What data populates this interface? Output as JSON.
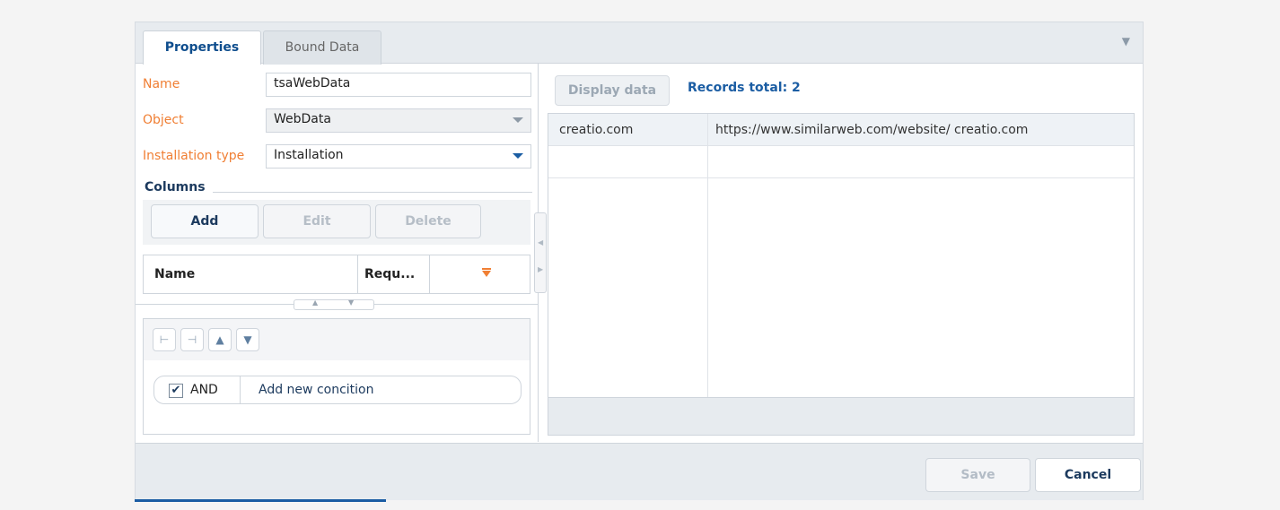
{
  "tabs": [
    {
      "label": "Properties",
      "active": true
    },
    {
      "label": "Bound Data",
      "active": false
    }
  ],
  "tabbar_menu_icon": "filter-menu-icon",
  "form": {
    "name_label": "Name",
    "name_value": "tsaWebData",
    "object_label": "Object",
    "object_value": "WebData",
    "installation_label": "Installation type",
    "installation_value": "Installation"
  },
  "columns": {
    "title": "Columns",
    "add_label": "Add",
    "edit_label": "Edit",
    "delete_label": "Delete",
    "headers": [
      "Name",
      "Requ..."
    ]
  },
  "filter": {
    "and_label": "AND",
    "and_checked": true,
    "add_condition_label": "Add new concition"
  },
  "data_panel": {
    "display_button": "Display data",
    "records_total": "Records total: 2",
    "rows": [
      {
        "c1": "creatio.com",
        "c2": "https://www.similarweb.com/website/ creatio.com"
      },
      {
        "c1": "",
        "c2": ""
      }
    ]
  },
  "footer": {
    "save_label": "Save",
    "cancel_label": "Cancel"
  },
  "colors": {
    "label_orange": "#f07f34",
    "accent_blue": "#1b5da3",
    "dark_blue": "#1c3a5e"
  }
}
